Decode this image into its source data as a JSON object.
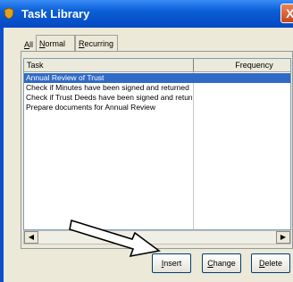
{
  "window": {
    "title": "Task Library",
    "close_glyph": "X",
    "app_icon": "shield-icon"
  },
  "tabs": [
    {
      "label": "All",
      "underline": "A",
      "rest": "ll"
    },
    {
      "label": "Normal",
      "underline": "N",
      "rest": "ormal"
    },
    {
      "label": "Recurring",
      "underline": "R",
      "rest": "ecurring"
    }
  ],
  "list": {
    "columns": [
      "Task",
      "Frequency"
    ],
    "rows": [
      {
        "task": "Annual Review of Trust",
        "frequency": "",
        "selected": true
      },
      {
        "task": "Check if Minutes have been signed and returned",
        "frequency": ""
      },
      {
        "task": "Check if Trust Deeds have been signed and returned",
        "frequency": ""
      },
      {
        "task": "Prepare documents for Annual Review",
        "frequency": ""
      }
    ]
  },
  "scrollbar": {
    "left_glyph": "◀",
    "right_glyph": "▶"
  },
  "buttons": {
    "insert": {
      "underline": "I",
      "rest": "nsert"
    },
    "change": {
      "underline": "C",
      "rest": "hange"
    },
    "delete": {
      "underline": "D",
      "rest": "elete"
    }
  },
  "colors": {
    "titlebar": "#0a5fd6",
    "selection": "#316ac5",
    "panel": "#ece9d8"
  },
  "annotation": {
    "type": "arrow",
    "points_to": "insert-button",
    "fill": "#ffffff",
    "stroke": "#000000"
  }
}
